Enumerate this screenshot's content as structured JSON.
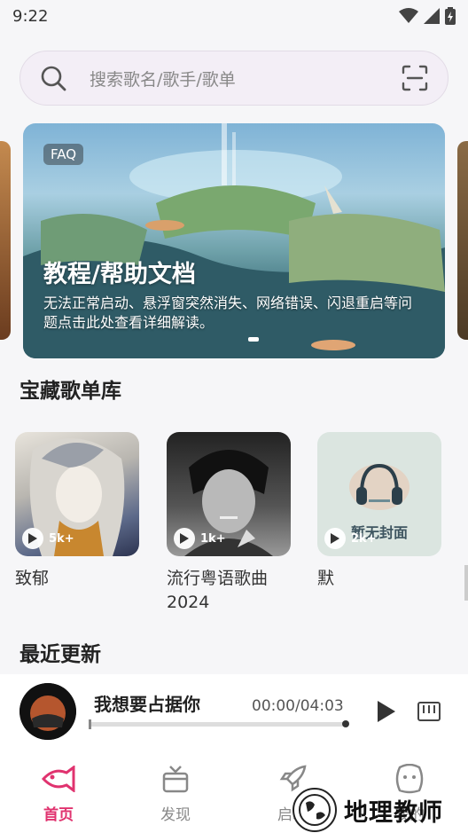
{
  "status_bar": {
    "time": "9:22"
  },
  "search": {
    "placeholder": "搜索歌名/歌手/歌单"
  },
  "banner": {
    "tag": "FAQ",
    "title": "教程/帮助文档",
    "description": "无法正常启动、悬浮窗突然消失、网络错误、闪退重启等问题点击此处查看详细解读。"
  },
  "sections": {
    "playlists_title": "宝藏歌单库",
    "recent_title": "最近更新"
  },
  "playlists": [
    {
      "name": "致郁",
      "plays": "5k+"
    },
    {
      "name": "流行粤语歌曲2024",
      "plays": "1k+"
    },
    {
      "name": "默",
      "plays": "2k+",
      "cover_text": "暂无封面"
    }
  ],
  "player": {
    "song": "我想要占据你",
    "time": "00:00/04:03",
    "progress": 0
  },
  "nav": [
    {
      "label": "首页",
      "icon": "fish-icon",
      "active": true
    },
    {
      "label": "发现",
      "icon": "gift-box-icon",
      "active": false
    },
    {
      "label": "启动",
      "icon": "rocket-icon",
      "active": false
    },
    {
      "label": "我的",
      "icon": "smile-face-icon",
      "active": false
    }
  ],
  "watermark": {
    "text": "地理教师"
  },
  "colors": {
    "accent": "#e0336f",
    "background": "#f6f6f8"
  }
}
